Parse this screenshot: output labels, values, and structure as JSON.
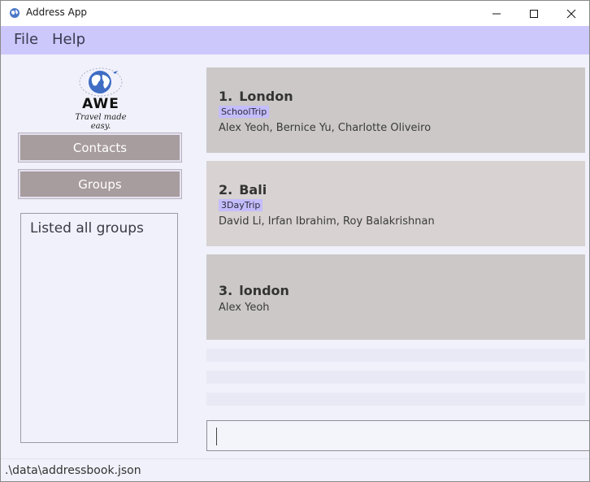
{
  "window": {
    "title": "Address App",
    "icon": "globe-icon"
  },
  "menu": {
    "file_label": "File",
    "help_label": "Help"
  },
  "logo": {
    "name": "AWE",
    "tagline": "Travel made easy."
  },
  "sidebar": {
    "contacts_label": "Contacts",
    "groups_label": "Groups",
    "result_text": "Listed all groups"
  },
  "groups": [
    {
      "index": "1.",
      "name": "London",
      "tag": "SchoolTrip",
      "members": "Alex Yeoh, Bernice Yu, Charlotte Oliveiro"
    },
    {
      "index": "2.",
      "name": "Bali",
      "tag": "3DayTrip",
      "members": "David Li, Irfan Ibrahim, Roy Balakrishnan"
    },
    {
      "index": "3.",
      "name": "london",
      "tag": "",
      "members": "Alex Yeoh"
    }
  ],
  "command": {
    "value": ""
  },
  "status": {
    "path": ".\\data\\addressbook.json"
  },
  "colors": {
    "menubar": "#ccc8fb",
    "tag": "#c4bdfb",
    "card": "#ccc8c8",
    "button": "#a79c9e"
  }
}
